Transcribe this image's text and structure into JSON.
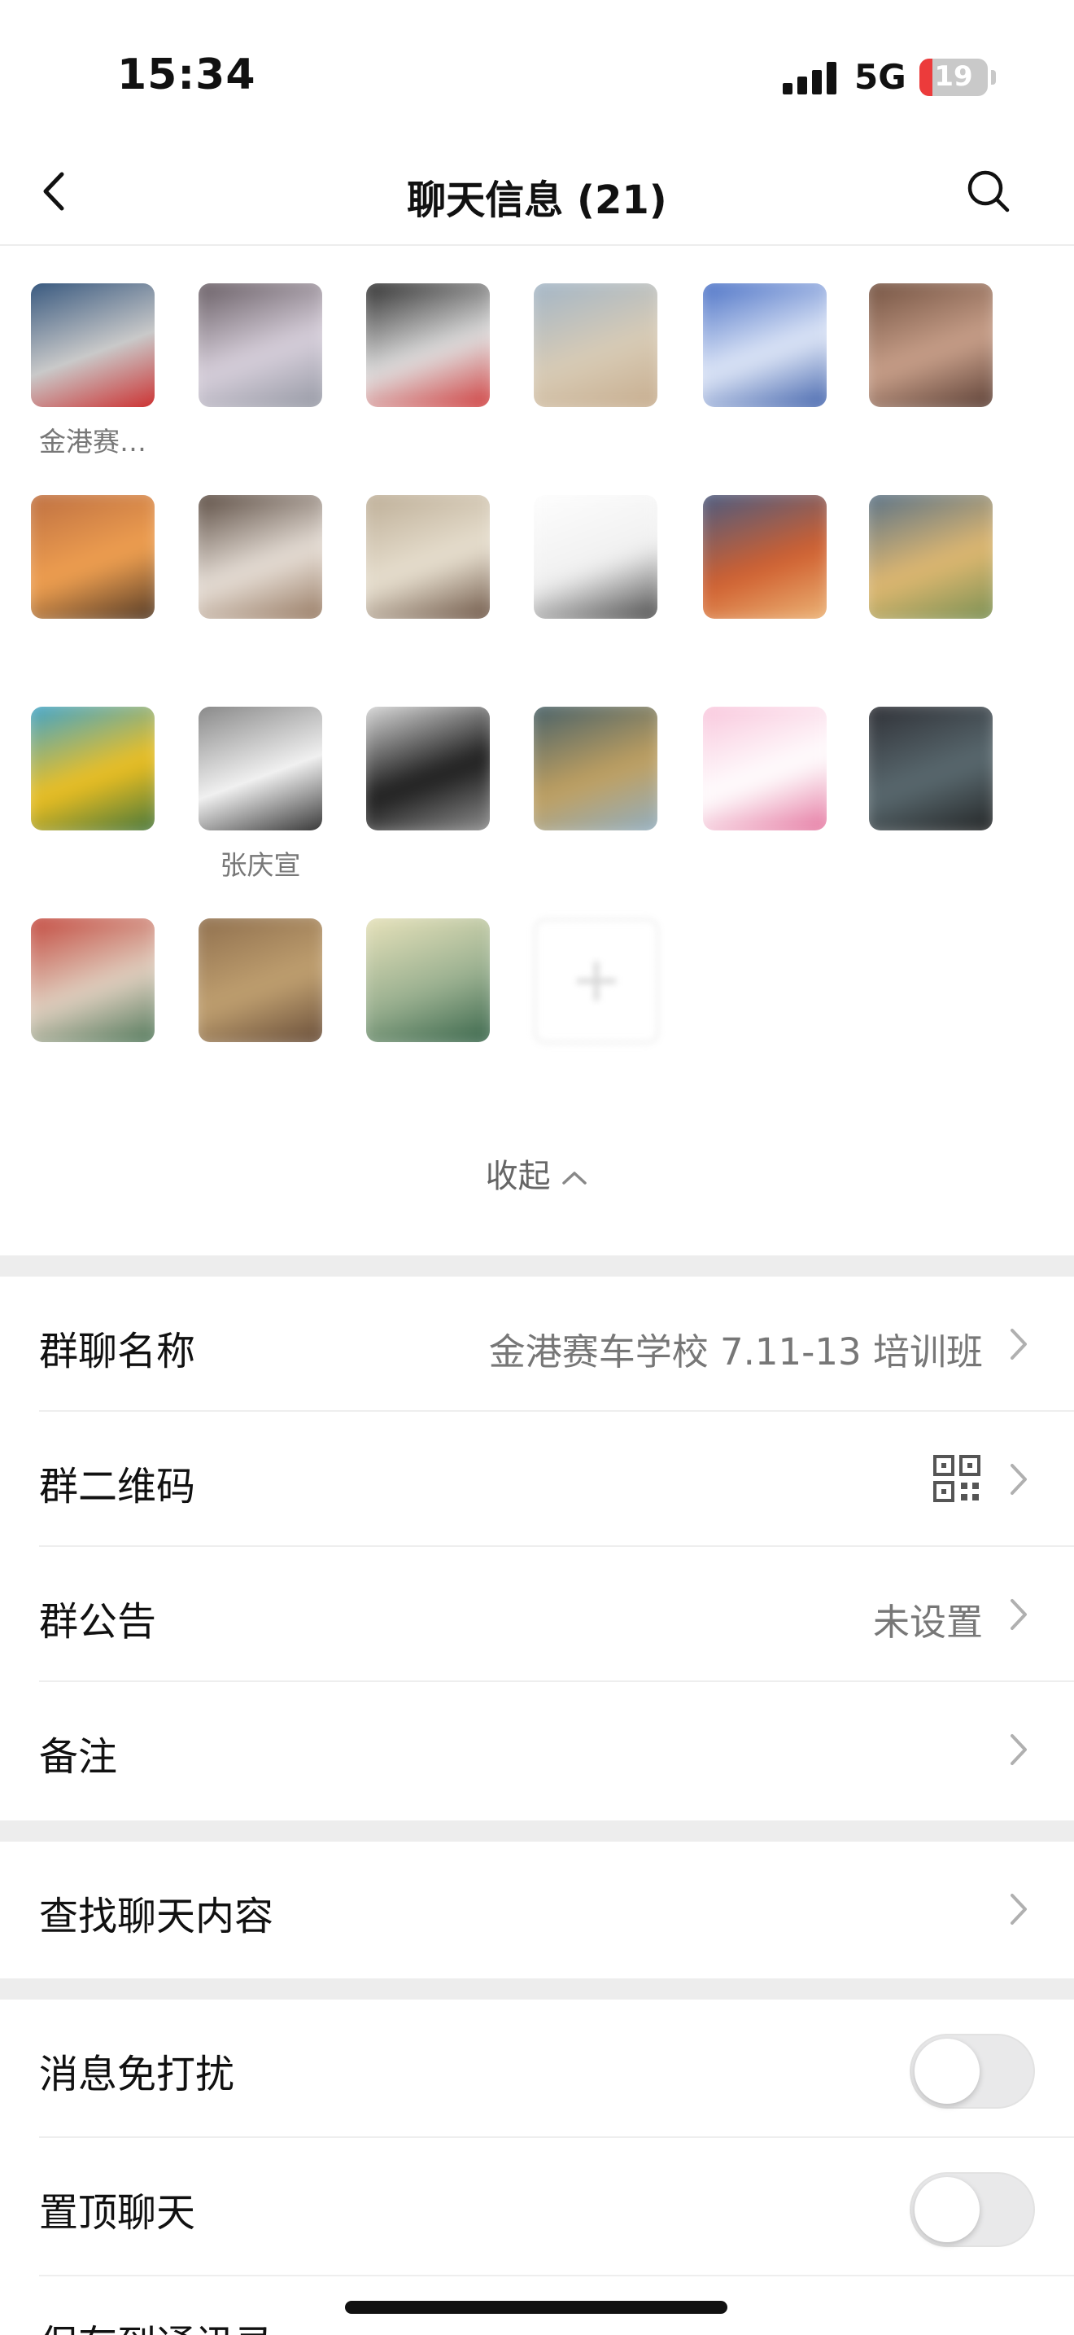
{
  "status_bar": {
    "time": "15:34",
    "network": "5G",
    "battery": "19",
    "battery_level": 0.19
  },
  "nav": {
    "title": "聊天信息 (21)",
    "back_icon": "chevron-left-icon",
    "search_icon": "search-icon"
  },
  "members": [
    {
      "name": "金港赛…",
      "blurred": false,
      "colors": [
        "#3a5a80",
        "#c9c9c9",
        "#c33"
      ]
    },
    {
      "name": "",
      "blurred": true,
      "colors": [
        "#5a4f55",
        "#d8d0dc",
        "#8a8f9a"
      ]
    },
    {
      "name": "",
      "blurred": true,
      "colors": [
        "#1a1a1a",
        "#e0e0e0",
        "#c22"
      ]
    },
    {
      "name": "",
      "blurred": true,
      "colors": [
        "#9cb3c9",
        "#d8cbb5",
        "#c4a888"
      ]
    },
    {
      "name": "",
      "blurred": true,
      "colors": [
        "#3a64c0",
        "#e0e8f8",
        "#2a4fa0"
      ]
    },
    {
      "name": "",
      "blurred": true,
      "colors": [
        "#6a4a3a",
        "#c9a08a",
        "#4a3028"
      ]
    },
    {
      "name": "",
      "blurred": true,
      "colors": [
        "#b86a40",
        "#f0a050",
        "#3a2a20"
      ]
    },
    {
      "name": "",
      "blurred": true,
      "colors": [
        "#4a3a30",
        "#e8e0d8",
        "#8a6a50"
      ]
    },
    {
      "name": "",
      "blurred": true,
      "colors": [
        "#b8a890",
        "#e8e0d0",
        "#5a4030"
      ]
    },
    {
      "name": "",
      "blurred": true,
      "colors": [
        "#ffffff",
        "#f0f0f0",
        "#333333"
      ]
    },
    {
      "name": "",
      "blurred": true,
      "colors": [
        "#3a5a8a",
        "#d06030",
        "#f0c080"
      ]
    },
    {
      "name": "",
      "blurred": true,
      "colors": [
        "#4a6a8a",
        "#e0b870",
        "#6a8a50"
      ]
    },
    {
      "name": "",
      "blurred": true,
      "colors": [
        "#2aa0e0",
        "#f0c020",
        "#2a6a40"
      ]
    },
    {
      "name": "张庆宣",
      "blurred": false,
      "colors": [
        "#8a8a8a",
        "#f0f0f0",
        "#3a3a3a"
      ]
    },
    {
      "name": "",
      "blurred": true,
      "colors": [
        "#f0f0f0",
        "#1a1a1a",
        "#a0a0a0"
      ]
    },
    {
      "name": "",
      "blurred": true,
      "colors": [
        "#3a5a6a",
        "#c0a060",
        "#8ab0d0"
      ]
    },
    {
      "name": "",
      "blurred": true,
      "colors": [
        "#f8c0d8",
        "#ffffff",
        "#e06090"
      ]
    },
    {
      "name": "",
      "blurred": true,
      "colors": [
        "#2a2a30",
        "#5a6a70",
        "#1a1a1a"
      ]
    },
    {
      "name": "",
      "blurred": true,
      "colors": [
        "#c03a30",
        "#e0d0c0",
        "#3a6a4a"
      ]
    },
    {
      "name": "",
      "blurred": true,
      "colors": [
        "#8a6a4a",
        "#c0a070",
        "#5a4030"
      ]
    },
    {
      "name": "",
      "blurred": true,
      "colors": [
        "#f0e8c0",
        "#9ab090",
        "#2a5a40"
      ]
    }
  ],
  "add_member_icon": "plus-icon",
  "collapse_label": "收起",
  "settings": {
    "group_name": {
      "label": "群聊名称",
      "value": "金港赛车学校 7.11-13 培训班"
    },
    "qr_code": {
      "label": "群二维码",
      "icon": "qr-code-icon"
    },
    "announcement": {
      "label": "群公告",
      "value": "未设置"
    },
    "remark": {
      "label": "备注"
    },
    "search_chat": {
      "label": "查找聊天内容"
    },
    "mute": {
      "label": "消息免打扰",
      "on": false
    },
    "pin": {
      "label": "置顶聊天",
      "on": false
    },
    "save_contacts": {
      "label": "保存到通讯录"
    }
  },
  "colors": {
    "background": "#ffffff",
    "section_gap": "#ededed",
    "secondary_text": "#777777"
  }
}
